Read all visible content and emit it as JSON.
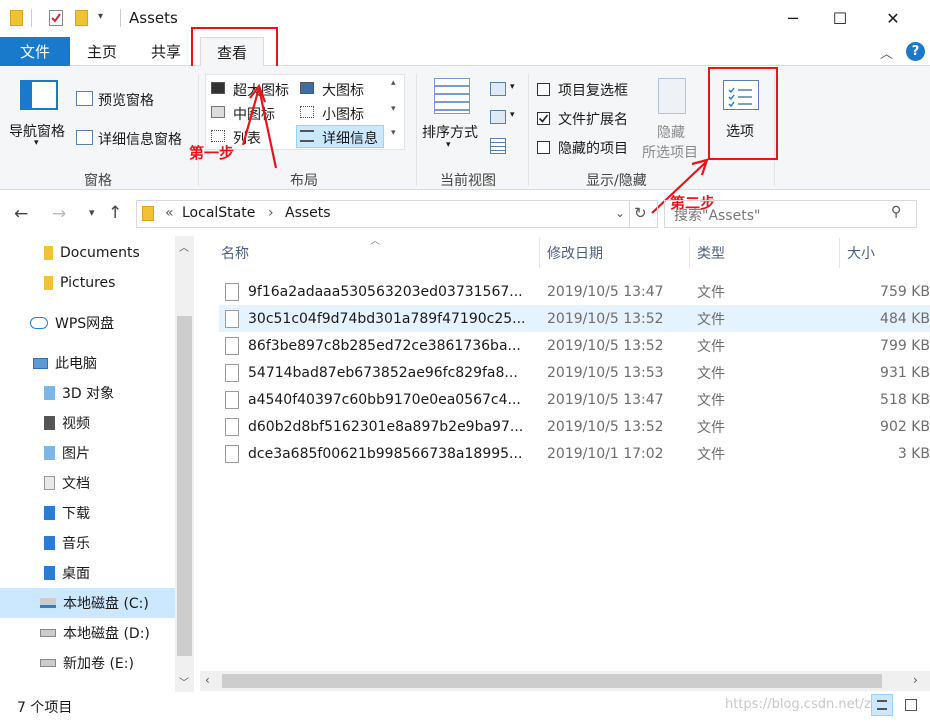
{
  "window": {
    "title": "Assets",
    "minimize": "─",
    "maximize": "☐",
    "close": "✕"
  },
  "tabs": {
    "file": "文件",
    "home": "主页",
    "share": "共享",
    "view": "查看"
  },
  "ribbon": {
    "pane": {
      "nav": "导航窗格",
      "preview": "预览窗格",
      "details": "详细信息窗格",
      "group": "窗格"
    },
    "layout": {
      "xlarge": "超大图标",
      "large": "大图标",
      "medium": "中图标",
      "small": "小图标",
      "list": "列表",
      "details": "详细信息",
      "group": "布局"
    },
    "current": {
      "sort": "排序方式",
      "group": "当前视图"
    },
    "show": {
      "checkboxes": "项目复选框",
      "extensions": "文件扩展名",
      "hidden": "隐藏的项目",
      "hide_selected_1": "隐藏",
      "hide_selected_2": "所选项目",
      "group": "显示/隐藏"
    },
    "options": "选项"
  },
  "annotations": {
    "step1": "第一步",
    "step2": "第二步"
  },
  "address": {
    "sep": "«",
    "crumb1": "LocalState",
    "arrow": "›",
    "crumb2": "Assets",
    "search_placeholder": "搜索\"Assets\""
  },
  "nav": [
    {
      "label": "Documents"
    },
    {
      "label": "Pictures"
    },
    {
      "label": "WPS网盘"
    },
    {
      "label": "此电脑"
    },
    {
      "label": "3D 对象"
    },
    {
      "label": "视频"
    },
    {
      "label": "图片"
    },
    {
      "label": "文档"
    },
    {
      "label": "下载"
    },
    {
      "label": "音乐"
    },
    {
      "label": "桌面"
    },
    {
      "label": "本地磁盘 (C:)"
    },
    {
      "label": "本地磁盘 (D:)"
    },
    {
      "label": "新加卷 (E:)"
    }
  ],
  "columns": {
    "name": "名称",
    "modified": "修改日期",
    "type": "类型",
    "size": "大小"
  },
  "files": [
    {
      "name": "9f16a2adaaa530563203ed03731567...",
      "date": "2019/10/5 13:47",
      "type": "文件",
      "size": "759 KB"
    },
    {
      "name": "30c51c04f9d74bd301a789f47190c25...",
      "date": "2019/10/5 13:52",
      "type": "文件",
      "size": "484 KB"
    },
    {
      "name": "86f3be897c8b285ed72ce3861736ba...",
      "date": "2019/10/5 13:52",
      "type": "文件",
      "size": "799 KB"
    },
    {
      "name": "54714bad87eb673852ae96fc829fa8...",
      "date": "2019/10/5 13:53",
      "type": "文件",
      "size": "931 KB"
    },
    {
      "name": "a4540f40397c60bb9170e0ea0567c4...",
      "date": "2019/10/5 13:47",
      "type": "文件",
      "size": "518 KB"
    },
    {
      "name": "d60b2d8bf5162301e8a897b2e9ba97...",
      "date": "2019/10/5 13:52",
      "type": "文件",
      "size": "902 KB"
    },
    {
      "name": "dce3a685f00621b998566738a18995...",
      "date": "2019/10/1 17:02",
      "type": "文件",
      "size": "3 KB"
    }
  ],
  "status": {
    "count": "7 个项目",
    "watermark": "https://blog.csdn.net/zyq_"
  },
  "colors": {
    "accent": "#1979ca",
    "annotation": "#e8141b",
    "selected_row": "#cce8ff"
  }
}
